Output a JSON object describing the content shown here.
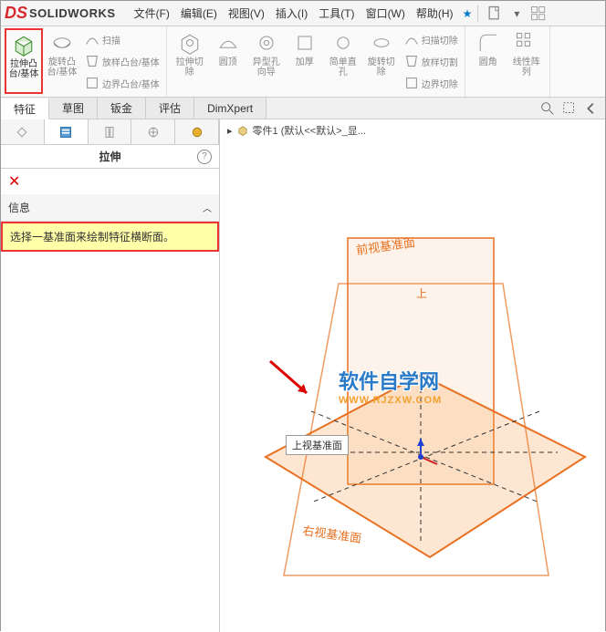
{
  "app": {
    "brand_prefix": "DS",
    "brand": "SOLIDWORKS"
  },
  "menu": {
    "file": "文件(F)",
    "edit": "编辑(E)",
    "view": "视图(V)",
    "insert": "插入(I)",
    "tools": "工具(T)",
    "window": "窗口(W)",
    "help": "帮助(H)"
  },
  "ribbon": {
    "extrude": "拉伸凸台/基体",
    "revolve": "旋转凸台/基体",
    "sweep": "扫描",
    "loft": "放样凸台/基体",
    "boundary": "边界凸台/基体",
    "cut_extrude": "拉伸切除",
    "cut_revolve": "圆顶",
    "hole": "异型孔向导",
    "thicken": "加厚",
    "simple": "简单直孔",
    "cut_rev2": "旋转切除",
    "cut_sweep": "扫描切除",
    "cut_loft": "放样切割",
    "cut_boundary": "边界切除",
    "fillet": "圆角",
    "pattern": "线性阵列"
  },
  "tabs": {
    "features": "特征",
    "sketch": "草图",
    "sheetmetal": "钣金",
    "evaluate": "评估",
    "dimxpert": "DimXpert"
  },
  "panel": {
    "title": "拉伸",
    "section_info": "信息",
    "msg": "选择一基准面来绘制特征横断面。"
  },
  "tree": {
    "part_label": "零件1  (默认<<默认>_显..."
  },
  "viewport": {
    "plane_front": "前视基准面",
    "plane_top": "上视基准面",
    "plane_right": "右视基准面",
    "tooltip": "上视基准面",
    "watermark": "软件自学网",
    "watermark_url": "WWW.RJZXW.COM"
  }
}
